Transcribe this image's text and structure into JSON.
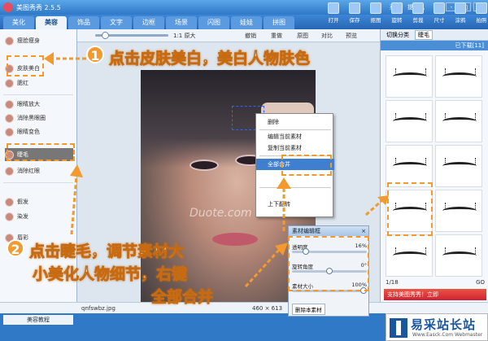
{
  "app": {
    "title": "美图秀秀 2.5.5",
    "menu_links": [
      "菜单",
      "提意见"
    ],
    "window_buttons": [
      "-",
      "□",
      "×"
    ]
  },
  "tabs": [
    {
      "label": "美化",
      "active": false
    },
    {
      "label": "美容",
      "active": true
    },
    {
      "label": "饰品",
      "active": false
    },
    {
      "label": "文字",
      "active": false
    },
    {
      "label": "边框",
      "active": false
    },
    {
      "label": "场景",
      "active": false
    },
    {
      "label": "闪图",
      "active": false
    },
    {
      "label": "娃娃",
      "active": false
    },
    {
      "label": "拼图",
      "active": false
    }
  ],
  "toolbar": [
    "打开",
    "保存",
    "抠图",
    "旋转",
    "剪裁",
    "尺寸",
    "涂鸦",
    "拍照",
    "截图"
  ],
  "left_panel": {
    "items": [
      "瘦脸瘦身",
      "皮肤美白",
      "腮红",
      "眼睛放大",
      "消除黑眼圈",
      "眼睛变色",
      "睫毛",
      "消除红眼",
      "假发",
      "染发",
      "唇彩"
    ],
    "selected": "睫毛",
    "bottom_button": "美容教程"
  },
  "center": {
    "zoom_label": "1:1 原大",
    "toolbar_labels": [
      "撤销",
      "重做",
      "原图",
      "对比",
      "预览"
    ],
    "file_name": "qnfswbz.jpg",
    "dimensions": "460 × 613",
    "watermark": "Duote.com"
  },
  "context_menu": {
    "items": [
      "删除",
      "编辑当前素材",
      "复制当前素材",
      "全部合并",
      "上下翻转"
    ],
    "highlighted": "全部合并"
  },
  "editor": {
    "title": "素材编辑框",
    "rows": [
      {
        "label": "透明度",
        "value": "16%",
        "fraction": 0.16
      },
      {
        "label": "旋转角度",
        "value": "0°",
        "fraction": 0.5
      },
      {
        "label": "素材大小",
        "value": "100%",
        "fraction": 1.0
      }
    ],
    "buttons": [
      "删除本素材"
    ]
  },
  "right_panel": {
    "tabs": [
      "切换分类",
      "睫毛"
    ],
    "subheader": "已下载[11]",
    "pager": "1/18",
    "promo": "支持美图秀秀！立即",
    "go_button": "GO"
  },
  "annotations": {
    "step1_text": "点击皮肤美白，美白人物肤色",
    "step2_line1": "点击睫毛，调节素材大",
    "step2_line2": "小美化人物细节，右键",
    "step2_line3": "全部合并",
    "badge1": "1",
    "badge2": "2"
  },
  "brand": {
    "name": "易采站长站",
    "url": "Www.Easck.Com Webmaster"
  },
  "colors": {
    "accent_blue": "#2e78c8",
    "annotation_orange": "#f39a2e",
    "menu_highlight": "#3e7fd0"
  }
}
